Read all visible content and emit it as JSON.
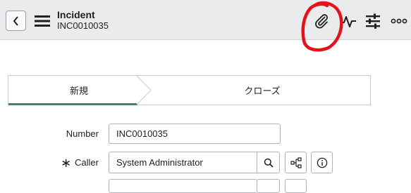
{
  "header": {
    "back_icon": "chevron-left-icon",
    "menu_icon": "hamburger-menu-icon",
    "title": "Incident",
    "subtitle": "INC0010035",
    "actions": [
      {
        "name": "attachment-icon"
      },
      {
        "name": "activity-stream-icon"
      },
      {
        "name": "settings-sliders-icon"
      },
      {
        "name": "more-options-icon"
      }
    ]
  },
  "annotation": {
    "color": "#e4121b"
  },
  "process_flow": {
    "stages": [
      {
        "label": "新規",
        "active": true
      },
      {
        "label": "クローズ",
        "active": false
      }
    ],
    "active_color": "#2e8a77"
  },
  "form": {
    "number": {
      "label": "Number",
      "value": "INC0010035"
    },
    "caller": {
      "label": "Caller",
      "value": "System Administrator",
      "required_mark": "∗"
    }
  }
}
